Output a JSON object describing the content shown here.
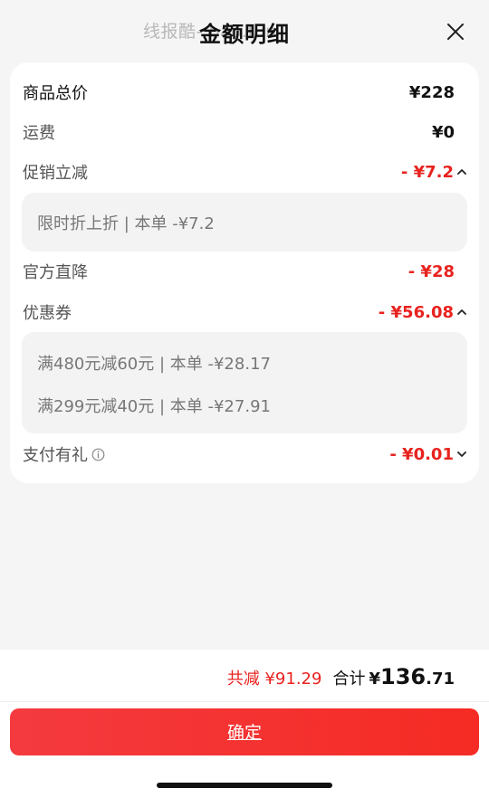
{
  "header": {
    "watermark": "线报酷-  bao.fun",
    "title": "金额明细"
  },
  "rows": {
    "total_price": {
      "label": "商品总价",
      "value": "¥228"
    },
    "shipping": {
      "label": "运费",
      "value": "¥0"
    },
    "promo": {
      "label": "促销立减",
      "value": "- ¥7.2",
      "details": [
        "限时折上折 | 本单 -¥7.2"
      ]
    },
    "official": {
      "label": "官方直降",
      "value": "- ¥28"
    },
    "coupon": {
      "label": "优惠券",
      "value": "- ¥56.08",
      "details": [
        "满480元减60元 | 本单 -¥28.17",
        "满299元减40元 | 本单 -¥27.91"
      ]
    },
    "pay_gift": {
      "label": "支付有礼",
      "value": "- ¥0.01"
    }
  },
  "summary": {
    "saved": "共减 ¥91.29",
    "total_label": "合计",
    "total_currency": "¥",
    "total_int": "136",
    "total_dec": ".71"
  },
  "confirm_label": "确定",
  "colors": {
    "accent": "#e8231f",
    "button_start": "#f43a3f",
    "button_end": "#f52b24"
  },
  "icons": {
    "close": "close-icon",
    "expand_up": "chevron-up-icon",
    "expand_down": "chevron-down-icon",
    "info": "info-icon"
  }
}
